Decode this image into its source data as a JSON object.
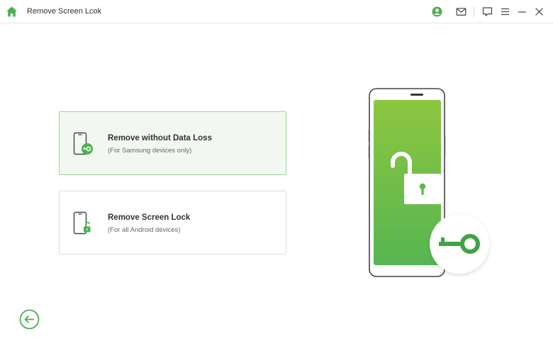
{
  "window": {
    "title": "Remove Screen Lcok"
  },
  "titlebar": {
    "icons": [
      "home-icon",
      "account-icon",
      "mail-icon",
      "feedback-icon",
      "menu-icon",
      "minimize-icon",
      "close-icon"
    ]
  },
  "options": [
    {
      "title": "Remove without Data Loss",
      "subtitle": "(For Samsung devices only)",
      "icon": "phone-key-icon",
      "selected": true
    },
    {
      "title": "Remove Screen Lock",
      "subtitle": "(For all Android devices)",
      "icon": "phone-unlock-icon",
      "selected": false
    }
  ],
  "illustration": {
    "icons": [
      "phone-illustration",
      "unlocked-padlock-icon",
      "key-badge-icon"
    ]
  },
  "navigation": {
    "back_icon": "back-arrow-icon"
  },
  "colors": {
    "accent": "#4cb050",
    "accent_dark": "#3ea444",
    "phone_gradient_top": "#8dc63f",
    "phone_gradient_bottom": "#56b652",
    "selected_card_bg": "#f2f8f1",
    "selected_card_border": "#9cd39a"
  }
}
